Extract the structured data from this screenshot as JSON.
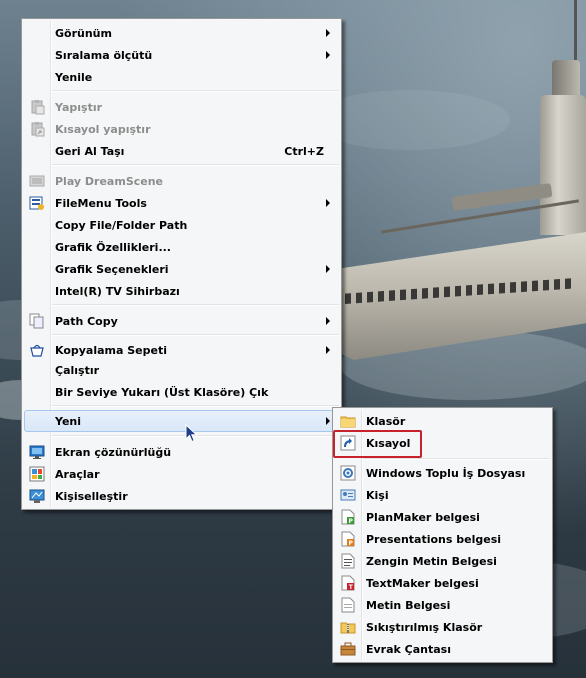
{
  "main_menu": {
    "items": [
      {
        "label": "Görünüm",
        "submenu": true
      },
      {
        "label": "Sıralama ölçütü",
        "submenu": true
      },
      {
        "label": "Yenile"
      },
      {
        "label": "Yapıştır",
        "disabled": true,
        "icon": "paste-icon"
      },
      {
        "label": "Kısayol yapıştır",
        "disabled": true,
        "icon": "paste-shortcut-icon"
      },
      {
        "label": "Geri Al Taşı",
        "shortcut": "Ctrl+Z"
      },
      {
        "label": "Play DreamScene",
        "disabled": true,
        "icon": "dreamscene-icon"
      },
      {
        "label": "FileMenu Tools",
        "submenu": true,
        "icon": "filemenu-tools-icon"
      },
      {
        "label": "Copy File/Folder Path"
      },
      {
        "label": "Grafik Özellikleri..."
      },
      {
        "label": "Grafik Seçenekleri",
        "submenu": true
      },
      {
        "label": "Intel(R) TV Sihirbazı"
      },
      {
        "label": "Path Copy",
        "submenu": true,
        "icon": "path-copy-icon"
      },
      {
        "label": "Kopyalama Sepeti",
        "submenu": true,
        "icon": "basket-icon"
      },
      {
        "label": "Çalıştır"
      },
      {
        "label": "Bir Seviye Yukarı (Üst Klasöre) Çık"
      },
      {
        "label": "Yeni",
        "submenu": true,
        "highlighted": true
      },
      {
        "label": "Ekran çözünürlüğü",
        "icon": "display-icon"
      },
      {
        "label": "Araçlar",
        "icon": "tools-icon"
      },
      {
        "label": "Kişiselleştir",
        "icon": "personalize-icon"
      }
    ]
  },
  "new_submenu": {
    "items": [
      {
        "label": "Klasör",
        "icon": "folder-icon"
      },
      {
        "label": "Kısayol",
        "icon": "shortcut-icon",
        "boxed": true
      },
      {
        "label": "Windows Toplu İş Dosyası",
        "icon": "batch-file-icon"
      },
      {
        "label": "Kişi",
        "icon": "contact-icon"
      },
      {
        "label": "PlanMaker belgesi",
        "icon": "planmaker-icon"
      },
      {
        "label": "Presentations belgesi",
        "icon": "presentations-icon"
      },
      {
        "label": "Zengin Metin Belgesi",
        "icon": "rtf-icon"
      },
      {
        "label": "TextMaker belgesi",
        "icon": "textmaker-icon"
      },
      {
        "label": "Metin Belgesi",
        "icon": "text-doc-icon"
      },
      {
        "label": "Sıkıştırılmış Klasör",
        "icon": "zip-folder-icon"
      },
      {
        "label": "Evrak Çantası",
        "icon": "briefcase-icon"
      }
    ]
  },
  "colors": {
    "menu_bg": "#f5f6f7",
    "highlight_bg": "#dce8f8",
    "highlight_border": "#a8c7ee",
    "annotation_box": "#c8232c",
    "disabled_text": "#8d8d8d"
  }
}
